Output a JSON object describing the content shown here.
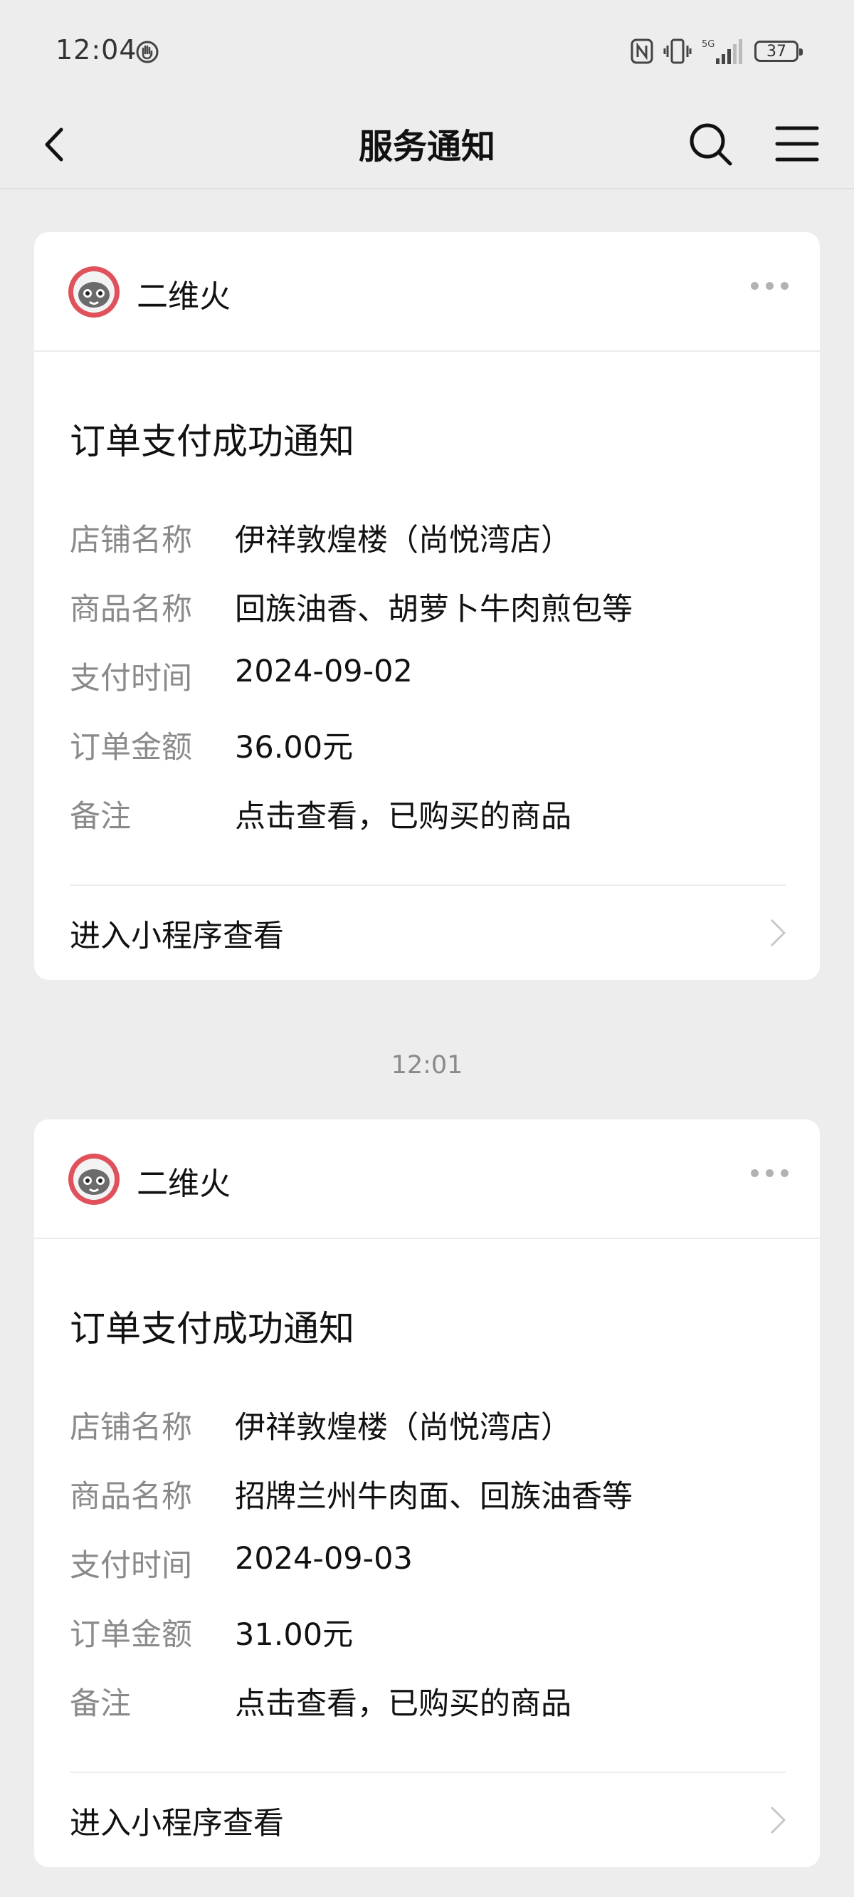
{
  "status_bar": {
    "time": "12:04",
    "network": "5G",
    "battery": "37"
  },
  "navbar": {
    "title": "服务通知"
  },
  "timestamp": "12:01",
  "cards": [
    {
      "sender": "二维火",
      "title": "订单支付成功通知",
      "rows": [
        {
          "label": "店铺名称",
          "value": "伊祥敦煌楼（尚悦湾店）"
        },
        {
          "label": "商品名称",
          "value": "回族油香、胡萝卜牛肉煎包等"
        },
        {
          "label": "支付时间",
          "value": "2024-09-02"
        },
        {
          "label": "订单金额",
          "value": "36.00元"
        },
        {
          "label": "备注",
          "value": "点击查看，已购买的商品"
        }
      ],
      "footer_link": "进入小程序查看"
    },
    {
      "sender": "二维火",
      "title": "订单支付成功通知",
      "rows": [
        {
          "label": "店铺名称",
          "value": "伊祥敦煌楼（尚悦湾店）"
        },
        {
          "label": "商品名称",
          "value": "招牌兰州牛肉面、回族油香等"
        },
        {
          "label": "支付时间",
          "value": "2024-09-03"
        },
        {
          "label": "订单金额",
          "value": "31.00元"
        },
        {
          "label": "备注",
          "value": "点击查看，已购买的商品"
        }
      ],
      "footer_link": "进入小程序查看"
    }
  ],
  "colors": {
    "background": "#ededed",
    "card": "#ffffff",
    "label_gray": "#8a8a8a",
    "avatar_ring": "#e0525b"
  },
  "icons": [
    "hand-icon",
    "nfc-icon",
    "vibrate-icon",
    "signal-icon",
    "back-arrow-icon",
    "search-icon",
    "menu-icon",
    "more-dots-icon",
    "chevron-right-icon"
  ]
}
